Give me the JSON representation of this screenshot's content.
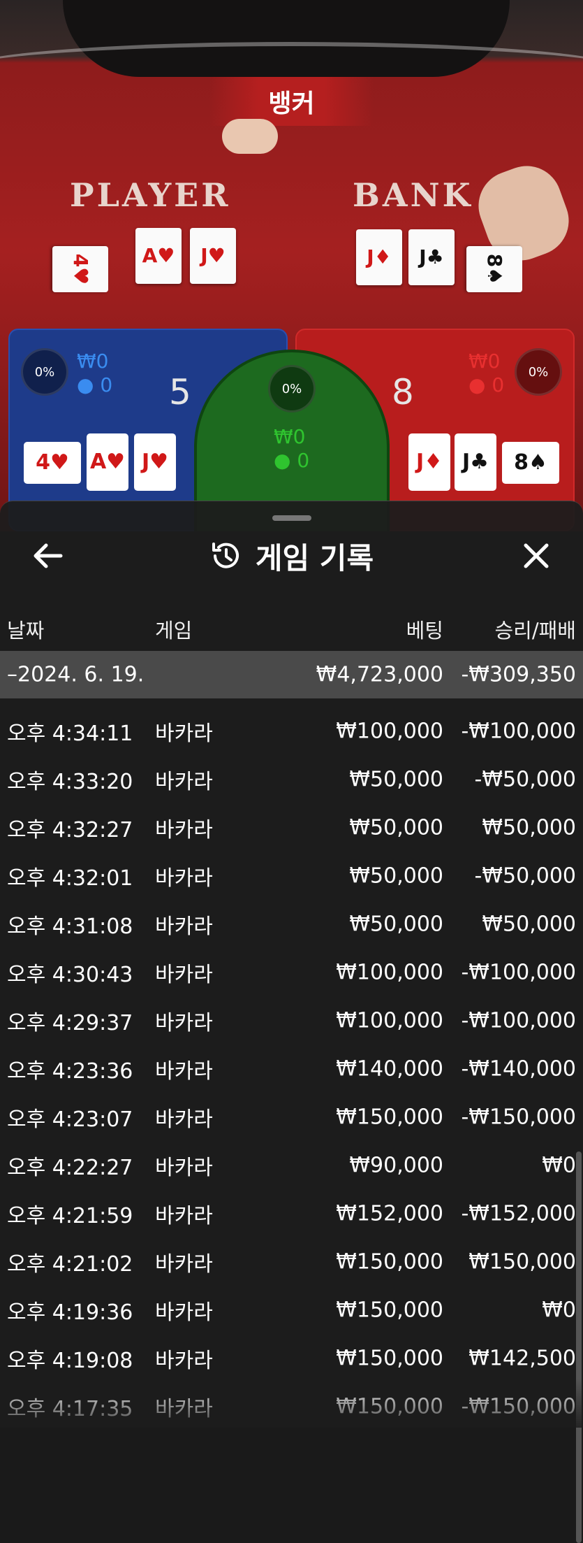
{
  "scene": {
    "winner_banner": "뱅커",
    "player_label": "PLAYER",
    "banker_label": "BANK",
    "player_cards": [
      "4♥",
      "A♥",
      "J♥"
    ],
    "banker_cards": [
      "J♦",
      "J♣",
      "8♠"
    ],
    "player_panel": {
      "pct": "0%",
      "amount": "₩0",
      "count": "0",
      "score": "5"
    },
    "tie_panel": {
      "pct": "0%",
      "amount": "₩0",
      "count": "0"
    },
    "banker_panel": {
      "pct": "0%",
      "amount": "₩0",
      "count": "0",
      "score": "8"
    }
  },
  "sheet": {
    "title": "게임 기록",
    "headers": {
      "date": "날짜",
      "game": "게임",
      "bet": "베팅",
      "result": "승리/패배"
    },
    "summary": {
      "date": "–2024. 6. 19.",
      "bet": "₩4,723,000",
      "result": "-₩309,350"
    },
    "rows": [
      {
        "time": "오후 4:34:11",
        "game": "바카라",
        "bet": "₩100,000",
        "result": "-₩100,000"
      },
      {
        "time": "오후 4:33:20",
        "game": "바카라",
        "bet": "₩50,000",
        "result": "-₩50,000"
      },
      {
        "time": "오후 4:32:27",
        "game": "바카라",
        "bet": "₩50,000",
        "result": "₩50,000"
      },
      {
        "time": "오후 4:32:01",
        "game": "바카라",
        "bet": "₩50,000",
        "result": "-₩50,000"
      },
      {
        "time": "오후 4:31:08",
        "game": "바카라",
        "bet": "₩50,000",
        "result": "₩50,000"
      },
      {
        "time": "오후 4:30:43",
        "game": "바카라",
        "bet": "₩100,000",
        "result": "-₩100,000"
      },
      {
        "time": "오후 4:29:37",
        "game": "바카라",
        "bet": "₩100,000",
        "result": "-₩100,000"
      },
      {
        "time": "오후 4:23:36",
        "game": "바카라",
        "bet": "₩140,000",
        "result": "-₩140,000"
      },
      {
        "time": "오후 4:23:07",
        "game": "바카라",
        "bet": "₩150,000",
        "result": "-₩150,000"
      },
      {
        "time": "오후 4:22:27",
        "game": "바카라",
        "bet": "₩90,000",
        "result": "₩0"
      },
      {
        "time": "오후 4:21:59",
        "game": "바카라",
        "bet": "₩152,000",
        "result": "-₩152,000"
      },
      {
        "time": "오후 4:21:02",
        "game": "바카라",
        "bet": "₩150,000",
        "result": "₩150,000"
      },
      {
        "time": "오후 4:19:36",
        "game": "바카라",
        "bet": "₩150,000",
        "result": "₩0"
      },
      {
        "time": "오후 4:19:08",
        "game": "바카라",
        "bet": "₩150,000",
        "result": "₩142,500"
      },
      {
        "time": "오후 4:17:35",
        "game": "바카라",
        "bet": "₩150,000",
        "result": "-₩150,000"
      }
    ]
  },
  "colors": {
    "player_blue": "#1e3b8a",
    "banker_red": "#b81d1d",
    "tie_green": "#1d6a1f",
    "sheet_bg": "#1c1c1c",
    "summary_bg": "#4a4a4a"
  }
}
